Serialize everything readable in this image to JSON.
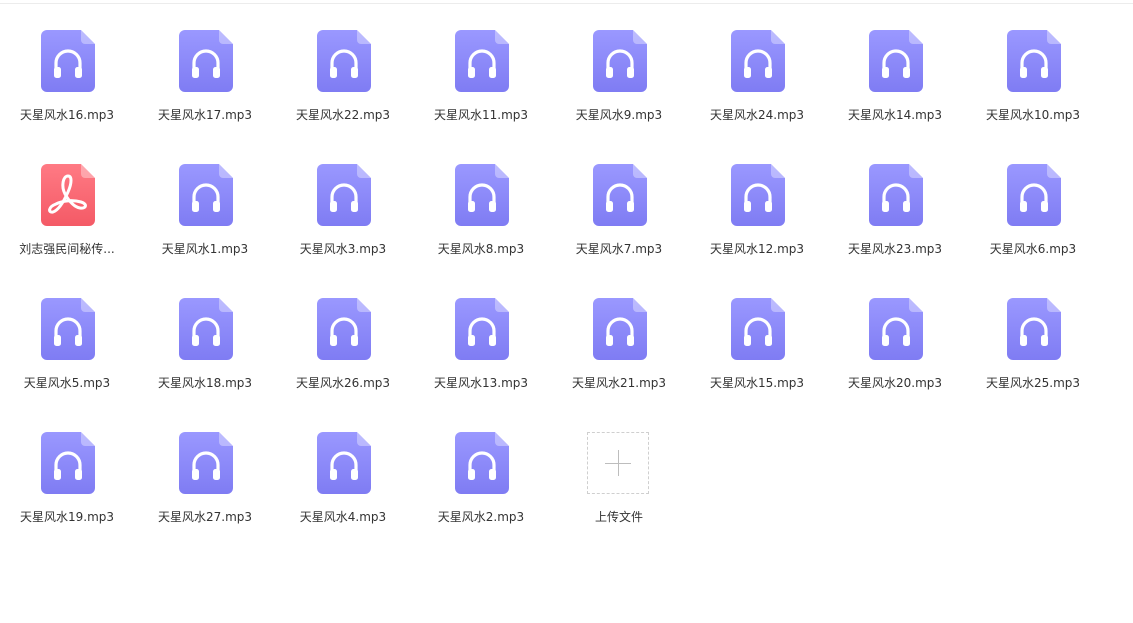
{
  "files": [
    {
      "name": "天星风水16.mp3",
      "type": "audio"
    },
    {
      "name": "天星风水17.mp3",
      "type": "audio"
    },
    {
      "name": "天星风水22.mp3",
      "type": "audio"
    },
    {
      "name": "天星风水11.mp3",
      "type": "audio"
    },
    {
      "name": "天星风水9.mp3",
      "type": "audio"
    },
    {
      "name": "天星风水24.mp3",
      "type": "audio"
    },
    {
      "name": "天星风水14.mp3",
      "type": "audio"
    },
    {
      "name": "天星风水10.mp3",
      "type": "audio"
    },
    {
      "name": "刘志强民间秘传...",
      "type": "pdf"
    },
    {
      "name": "天星风水1.mp3",
      "type": "audio"
    },
    {
      "name": "天星风水3.mp3",
      "type": "audio"
    },
    {
      "name": "天星风水8.mp3",
      "type": "audio"
    },
    {
      "name": "天星风水7.mp3",
      "type": "audio"
    },
    {
      "name": "天星风水12.mp3",
      "type": "audio"
    },
    {
      "name": "天星风水23.mp3",
      "type": "audio"
    },
    {
      "name": "天星风水6.mp3",
      "type": "audio"
    },
    {
      "name": "天星风水5.mp3",
      "type": "audio"
    },
    {
      "name": "天星风水18.mp3",
      "type": "audio"
    },
    {
      "name": "天星风水26.mp3",
      "type": "audio"
    },
    {
      "name": "天星风水13.mp3",
      "type": "audio"
    },
    {
      "name": "天星风水21.mp3",
      "type": "audio"
    },
    {
      "name": "天星风水15.mp3",
      "type": "audio"
    },
    {
      "name": "天星风水20.mp3",
      "type": "audio"
    },
    {
      "name": "天星风水25.mp3",
      "type": "audio"
    },
    {
      "name": "天星风水19.mp3",
      "type": "audio"
    },
    {
      "name": "天星风水27.mp3",
      "type": "audio"
    },
    {
      "name": "天星风水4.mp3",
      "type": "audio"
    },
    {
      "name": "天星风水2.mp3",
      "type": "audio"
    }
  ],
  "upload": {
    "label": "上传文件"
  },
  "colors": {
    "audio_icon_top": "#9a98ff",
    "audio_icon_bottom": "#7f7cf3",
    "pdf_icon_top": "#ff7a84",
    "pdf_icon_bottom": "#f45a66"
  }
}
